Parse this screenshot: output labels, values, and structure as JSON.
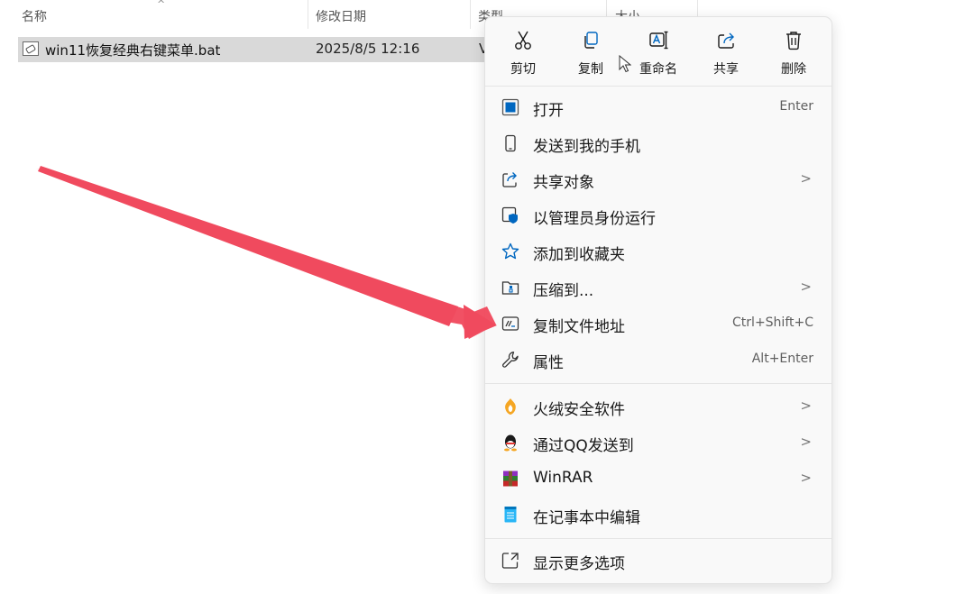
{
  "columns": {
    "name": "名称",
    "date": "修改日期",
    "type": "类型",
    "size": "大小"
  },
  "file": {
    "name": "win11恢复经典右键菜单.bat",
    "date": "2025/8/5 12:16",
    "type_partial": "V"
  },
  "quick_actions": [
    {
      "label": "剪切",
      "icon": "scissors-icon"
    },
    {
      "label": "复制",
      "icon": "copy-icon"
    },
    {
      "label": "重命名",
      "icon": "rename-icon"
    },
    {
      "label": "共享",
      "icon": "share-icon"
    },
    {
      "label": "删除",
      "icon": "trash-icon"
    }
  ],
  "menu_items": [
    {
      "label": "打开",
      "shortcut": "Enter",
      "icon": "open-icon"
    },
    {
      "label": "发送到我的手机",
      "shortcut": "",
      "icon": "phone-icon"
    },
    {
      "label": "共享对象",
      "shortcut": "",
      "icon": "share-to-icon",
      "submenu": true
    },
    {
      "label": "以管理员身份运行",
      "shortcut": "",
      "icon": "shield-icon"
    },
    {
      "label": "添加到收藏夹",
      "shortcut": "",
      "icon": "star-icon"
    },
    {
      "label": "压缩到...",
      "shortcut": "",
      "icon": "zip-icon",
      "submenu": true
    },
    {
      "label": "复制文件地址",
      "shortcut": "Ctrl+Shift+C",
      "icon": "copy-path-icon"
    },
    {
      "label": "属性",
      "shortcut": "Alt+Enter",
      "icon": "wrench-icon"
    }
  ],
  "third_party_items": [
    {
      "label": "火绒安全软件",
      "icon": "huorong-icon",
      "submenu": true
    },
    {
      "label": "通过QQ发送到",
      "icon": "qq-icon",
      "submenu": true
    },
    {
      "label": "WinRAR",
      "icon": "winrar-icon",
      "submenu": true
    },
    {
      "label": "在记事本中编辑",
      "icon": "notepad-icon",
      "submenu": false
    }
  ],
  "more_options": {
    "label": "显示更多选项",
    "icon": "more-options-icon"
  },
  "colors": {
    "accent": "#0067c0",
    "arrow": "#f04a5e",
    "selection": "#d9d9d9"
  }
}
